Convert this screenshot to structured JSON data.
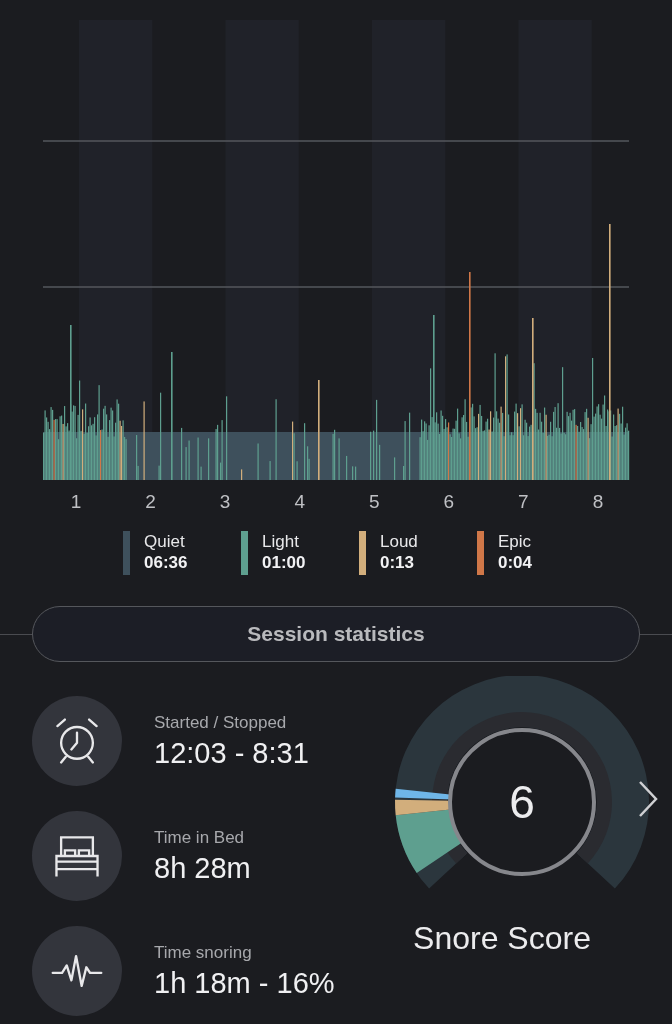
{
  "chart": {
    "hour_labels": [
      "1",
      "2",
      "3",
      "4",
      "5",
      "6",
      "7",
      "8"
    ]
  },
  "legend": [
    {
      "label": "Quiet",
      "value": "06:36",
      "color": "#3e505c"
    },
    {
      "label": "Light",
      "value": "01:00",
      "color": "#5e9f8f"
    },
    {
      "label": "Loud",
      "value": "0:13",
      "color": "#d2ae7c"
    },
    {
      "label": "Epic",
      "value": "0:04",
      "color": "#d07748"
    }
  ],
  "section_title": "Session statistics",
  "stats": [
    {
      "kind": "alarm",
      "label": "Started / Stopped",
      "value": "12:03 - 8:31"
    },
    {
      "kind": "bed",
      "label": "Time in Bed",
      "value": "8h 28m"
    },
    {
      "kind": "pulse",
      "label": "Time snoring",
      "value": "1h 18m - 16%"
    }
  ],
  "score": {
    "value": "6",
    "title": "Snore Score"
  }
}
